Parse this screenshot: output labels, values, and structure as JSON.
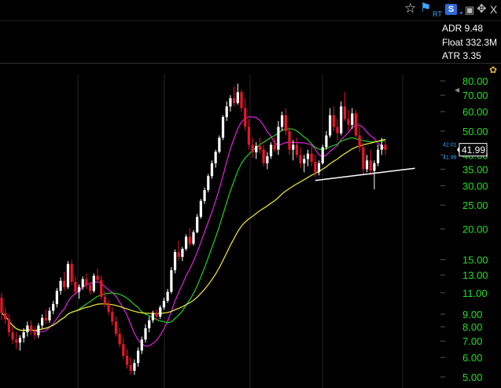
{
  "toolbar": {
    "icons": [
      {
        "name": "star-icon",
        "glyph": "☆"
      },
      {
        "name": "flag-icon",
        "glyph": "⚑"
      },
      {
        "name": "realtime-label",
        "text": "RT"
      },
      {
        "name": "study-icon",
        "text": "S"
      },
      {
        "name": "save-icon",
        "glyph": "▣"
      },
      {
        "name": "move-icon",
        "glyph": "✥"
      },
      {
        "name": "close-icon",
        "glyph": "X"
      }
    ]
  },
  "stats": {
    "adr": "ADR 9.48",
    "float": "Float 332.3M",
    "atr": "ATR 3.35"
  },
  "price_axis": {
    "ticks": [
      "80.00",
      "70.00",
      "60.00",
      "50.00",
      "40.00",
      "35.00",
      "30.00",
      "25.00",
      "20.00",
      "15.00",
      "13.00",
      "11.00",
      "9.00",
      "8.00",
      "7.00",
      "6.00",
      "5.00"
    ],
    "last_price": "41.99",
    "marker_high": "42.01",
    "marker_low": "41.99",
    "colors": {
      "ticks": "#22dd22",
      "up": "#ffffff",
      "down": "#e8162a",
      "ma_fast": "#d020d0",
      "ma_mid": "#22c022",
      "ma_slow": "#e6dc3c",
      "trendline": "#ffffff"
    }
  },
  "chart_data": {
    "type": "candlestick",
    "scale": "log",
    "ylim": [
      4.7,
      88
    ],
    "yticks": [
      80,
      70,
      60,
      50,
      40,
      35,
      30,
      25,
      20,
      15,
      13,
      11,
      9,
      8,
      7,
      6,
      5
    ],
    "candles": [
      [
        10.5,
        11,
        8.5,
        9.1
      ],
      [
        9.1,
        9.6,
        8.2,
        8.6
      ],
      [
        8.6,
        9,
        7.3,
        7.6
      ],
      [
        7.6,
        8,
        6.8,
        7.1
      ],
      [
        7.1,
        7.6,
        6.5,
        6.9
      ],
      [
        6.9,
        7.4,
        6.4,
        7.2
      ],
      [
        7.2,
        7.9,
        6.9,
        7.6
      ],
      [
        7.6,
        8.4,
        7.3,
        8.1
      ],
      [
        8.1,
        8.5,
        7.4,
        7.7
      ],
      [
        7.7,
        8,
        7.1,
        7.4
      ],
      [
        7.4,
        8.3,
        7.2,
        8.1
      ],
      [
        8.1,
        9,
        7.9,
        8.7
      ],
      [
        8.7,
        9.4,
        8.2,
        8.5
      ],
      [
        8.5,
        9.6,
        8.3,
        9.3
      ],
      [
        9.3,
        10.2,
        9,
        9.9
      ],
      [
        9.9,
        11.5,
        9.6,
        11.2
      ],
      [
        11.2,
        12.7,
        10.8,
        12.3
      ],
      [
        12.3,
        13.4,
        11.2,
        11.6
      ],
      [
        11.6,
        14.8,
        11.4,
        14.4
      ],
      [
        14.4,
        14.9,
        11.8,
        12.2
      ],
      [
        12.2,
        12.8,
        10.8,
        11.1
      ],
      [
        11.1,
        11.9,
        10.4,
        11.6
      ],
      [
        11.6,
        12.8,
        11.3,
        12.5
      ],
      [
        12.5,
        13.2,
        11.4,
        11.8
      ],
      [
        11.8,
        12.2,
        10.8,
        11.2
      ],
      [
        11.2,
        13.2,
        11,
        12.9
      ],
      [
        12.9,
        13.8,
        12.1,
        12.4
      ],
      [
        12.4,
        12.9,
        10.3,
        10.6
      ],
      [
        10.6,
        11.2,
        9.6,
        9.9
      ],
      [
        9.9,
        10.3,
        8.9,
        9.2
      ],
      [
        9.2,
        9.6,
        8.1,
        8.4
      ],
      [
        8.4,
        8.8,
        7.3,
        7.5
      ],
      [
        7.5,
        7.9,
        6.6,
        6.8
      ],
      [
        6.8,
        7.2,
        5.9,
        6.1
      ],
      [
        6.1,
        6.5,
        5.4,
        5.6
      ],
      [
        5.6,
        6,
        5.1,
        5.3
      ],
      [
        5.3,
        5.9,
        5.1,
        5.7
      ],
      [
        5.7,
        6.6,
        5.5,
        6.4
      ],
      [
        6.4,
        7.3,
        6.2,
        7.1
      ],
      [
        7.1,
        8.2,
        6.9,
        7.9
      ],
      [
        7.9,
        8.8,
        7.6,
        8.5
      ],
      [
        8.5,
        9.3,
        8.3,
        9.1
      ],
      [
        9.1,
        9.4,
        8.5,
        8.8
      ],
      [
        8.8,
        9.8,
        8.6,
        9.6
      ],
      [
        9.6,
        10.5,
        9.4,
        10.2
      ],
      [
        10.2,
        11.4,
        10,
        11.1
      ],
      [
        11.1,
        14,
        10.9,
        13.6
      ],
      [
        13.6,
        16.5,
        13.2,
        16.1
      ],
      [
        16.1,
        17.9,
        14.9,
        15.4
      ],
      [
        15.4,
        16.9,
        14.8,
        16.6
      ],
      [
        16.6,
        19,
        16.3,
        18.6
      ],
      [
        18.6,
        20.2,
        16.9,
        17.4
      ],
      [
        17.4,
        19.8,
        17.1,
        19.4
      ],
      [
        19.4,
        23,
        19.2,
        22.4
      ],
      [
        22.4,
        26.5,
        22,
        26
      ],
      [
        26,
        29.5,
        25.3,
        28.8
      ],
      [
        28.8,
        33.5,
        28.2,
        32.8
      ],
      [
        32.8,
        38,
        32,
        37
      ],
      [
        37,
        42,
        35.5,
        41.2
      ],
      [
        41.2,
        48,
        40.5,
        47
      ],
      [
        47,
        58,
        46,
        57
      ],
      [
        57,
        66,
        55,
        63
      ],
      [
        63,
        70,
        60,
        68
      ],
      [
        68,
        76,
        63,
        65
      ],
      [
        65,
        78,
        64,
        72
      ],
      [
        72,
        74,
        60,
        62
      ],
      [
        62,
        68,
        50,
        52
      ],
      [
        52,
        56,
        42,
        44
      ],
      [
        44,
        47,
        39,
        41
      ],
      [
        41,
        45,
        38.5,
        43.5
      ],
      [
        43.5,
        47,
        40.5,
        42
      ],
      [
        42,
        44,
        36,
        37
      ],
      [
        37,
        41,
        35,
        39.5
      ],
      [
        39.5,
        45,
        38.5,
        44
      ],
      [
        44,
        47,
        41,
        42
      ],
      [
        42,
        55,
        40,
        52
      ],
      [
        52,
        60,
        50,
        58
      ],
      [
        58,
        62,
        48,
        50
      ],
      [
        50,
        52,
        40,
        42
      ],
      [
        42,
        46,
        38,
        44
      ],
      [
        44,
        47,
        39,
        40
      ],
      [
        40,
        43,
        35.5,
        37
      ],
      [
        37,
        40,
        34,
        38.5
      ],
      [
        38.5,
        42,
        36,
        40.5
      ],
      [
        40.5,
        44,
        36,
        37.5
      ],
      [
        37.5,
        40,
        32.5,
        34
      ],
      [
        34,
        38,
        33,
        37
      ],
      [
        37,
        44,
        36.5,
        43
      ],
      [
        43,
        50,
        42,
        48
      ],
      [
        48,
        62,
        47,
        58
      ],
      [
        58,
        63,
        50,
        52
      ],
      [
        52,
        56,
        46,
        49
      ],
      [
        49,
        66,
        48,
        63
      ],
      [
        63,
        72,
        55,
        56
      ],
      [
        56,
        61,
        50,
        53
      ],
      [
        53,
        62,
        51,
        59
      ],
      [
        59,
        61,
        47,
        48
      ],
      [
        48,
        52,
        41,
        43
      ],
      [
        43,
        45,
        33,
        35
      ],
      [
        35,
        40,
        34,
        38
      ],
      [
        38,
        42,
        33,
        34.5
      ],
      [
        34.5,
        38,
        29,
        37
      ],
      [
        37,
        44,
        36,
        42
      ],
      [
        42,
        47,
        40,
        44
      ],
      [
        44,
        46,
        40,
        41.99
      ]
    ],
    "moving_averages": [
      {
        "period": 10
      },
      {
        "period": 20
      },
      {
        "period": 50
      }
    ],
    "trendline": {
      "from_candle": 85,
      "to_candle": 112,
      "y_from": 31.5,
      "y_to": 35.3
    }
  }
}
